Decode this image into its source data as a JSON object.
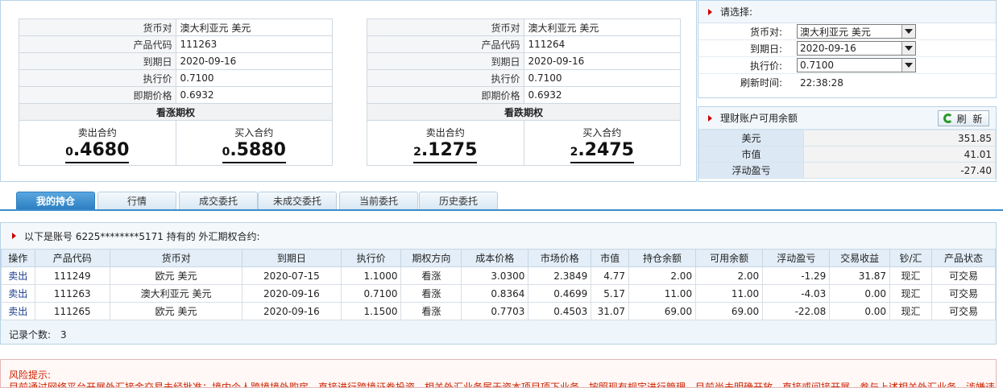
{
  "left_quote": {
    "rows": [
      {
        "label": "货币对",
        "value": "澳大利亚元 美元"
      },
      {
        "label": "产品代码",
        "value": "111263"
      },
      {
        "label": "到期日",
        "value": "2020-09-16"
      },
      {
        "label": "执行价",
        "value": "0.7100"
      },
      {
        "label": "即期价格",
        "value": "0.6932"
      }
    ],
    "kind": "看涨期权",
    "sell_label": "卖出合约",
    "sell_int": "0",
    "sell_frac": ".4680",
    "buy_label": "买入合约",
    "buy_int": "0",
    "buy_frac": ".5880"
  },
  "right_quote": {
    "rows": [
      {
        "label": "货币对",
        "value": "澳大利亚元 美元"
      },
      {
        "label": "产品代码",
        "value": "111264"
      },
      {
        "label": "到期日",
        "value": "2020-09-16"
      },
      {
        "label": "执行价",
        "value": "0.7100"
      },
      {
        "label": "即期价格",
        "value": "0.6932"
      }
    ],
    "kind": "看跌期权",
    "sell_label": "卖出合约",
    "sell_int": "2",
    "sell_frac": ".1275",
    "buy_label": "买入合约",
    "buy_int": "2",
    "buy_frac": ".2475"
  },
  "select_panel": {
    "title": "请选择:",
    "currency_label": "货币对:",
    "currency_value": "澳大利亚元 美元",
    "expiry_label": "到期日:",
    "expiry_value": "2020-09-16",
    "strike_label": "执行价:",
    "strike_value": "0.7100",
    "refresh_label": "刷新时间:",
    "refresh_time": "22:38:28"
  },
  "balance_panel": {
    "title": "理财账户可用余额",
    "refresh_button": "刷 新",
    "rows": [
      {
        "label": "美元",
        "value": "351.85"
      },
      {
        "label": "市值",
        "value": "41.01"
      },
      {
        "label": "浮动盈亏",
        "value": "-27.40"
      }
    ]
  },
  "tabs": [
    "我的持仓",
    "行情",
    "成交委托",
    "未成交委托",
    "当前委托",
    "历史委托"
  ],
  "holdings": {
    "title": "以下是账号 6225********5171 持有的 外汇期权合约:",
    "columns": [
      "操作",
      "产品代码",
      "货币对",
      "到期日",
      "执行价",
      "期权方向",
      "成本价格",
      "市场价格",
      "市值",
      "持仓余额",
      "可用余额",
      "浮动盈亏",
      "交易收益",
      "钞/汇",
      "产品状态"
    ],
    "rows": [
      [
        "卖出",
        "111249",
        "欧元 美元",
        "2020-07-15",
        "1.1000",
        "看涨",
        "3.0300",
        "2.3849",
        "4.77",
        "2.00",
        "2.00",
        "-1.29",
        "31.87",
        "现汇",
        "可交易"
      ],
      [
        "卖出",
        "111263",
        "澳大利亚元 美元",
        "2020-09-16",
        "0.7100",
        "看涨",
        "0.8364",
        "0.4699",
        "5.17",
        "11.00",
        "11.00",
        "-4.03",
        "0.00",
        "现汇",
        "可交易"
      ],
      [
        "卖出",
        "111265",
        "欧元 美元",
        "2020-09-16",
        "1.1500",
        "看涨",
        "0.7703",
        "0.4503",
        "31.07",
        "69.00",
        "69.00",
        "-22.08",
        "0.00",
        "现汇",
        "可交易"
      ]
    ],
    "count_label": "记录个数:",
    "count": "3"
  },
  "risk": {
    "title": "风险提示:",
    "text": "目前通过网络平台开展外汇接金交易未经批准；境内个人跨境境外购房、直接进行跨境证券投资、相关外汇业务属于资本项目项下业务，按照现有规定进行管理，目前尚未明确开放。直接或间接开展、参与上述相关外汇业务，涉嫌违"
  }
}
